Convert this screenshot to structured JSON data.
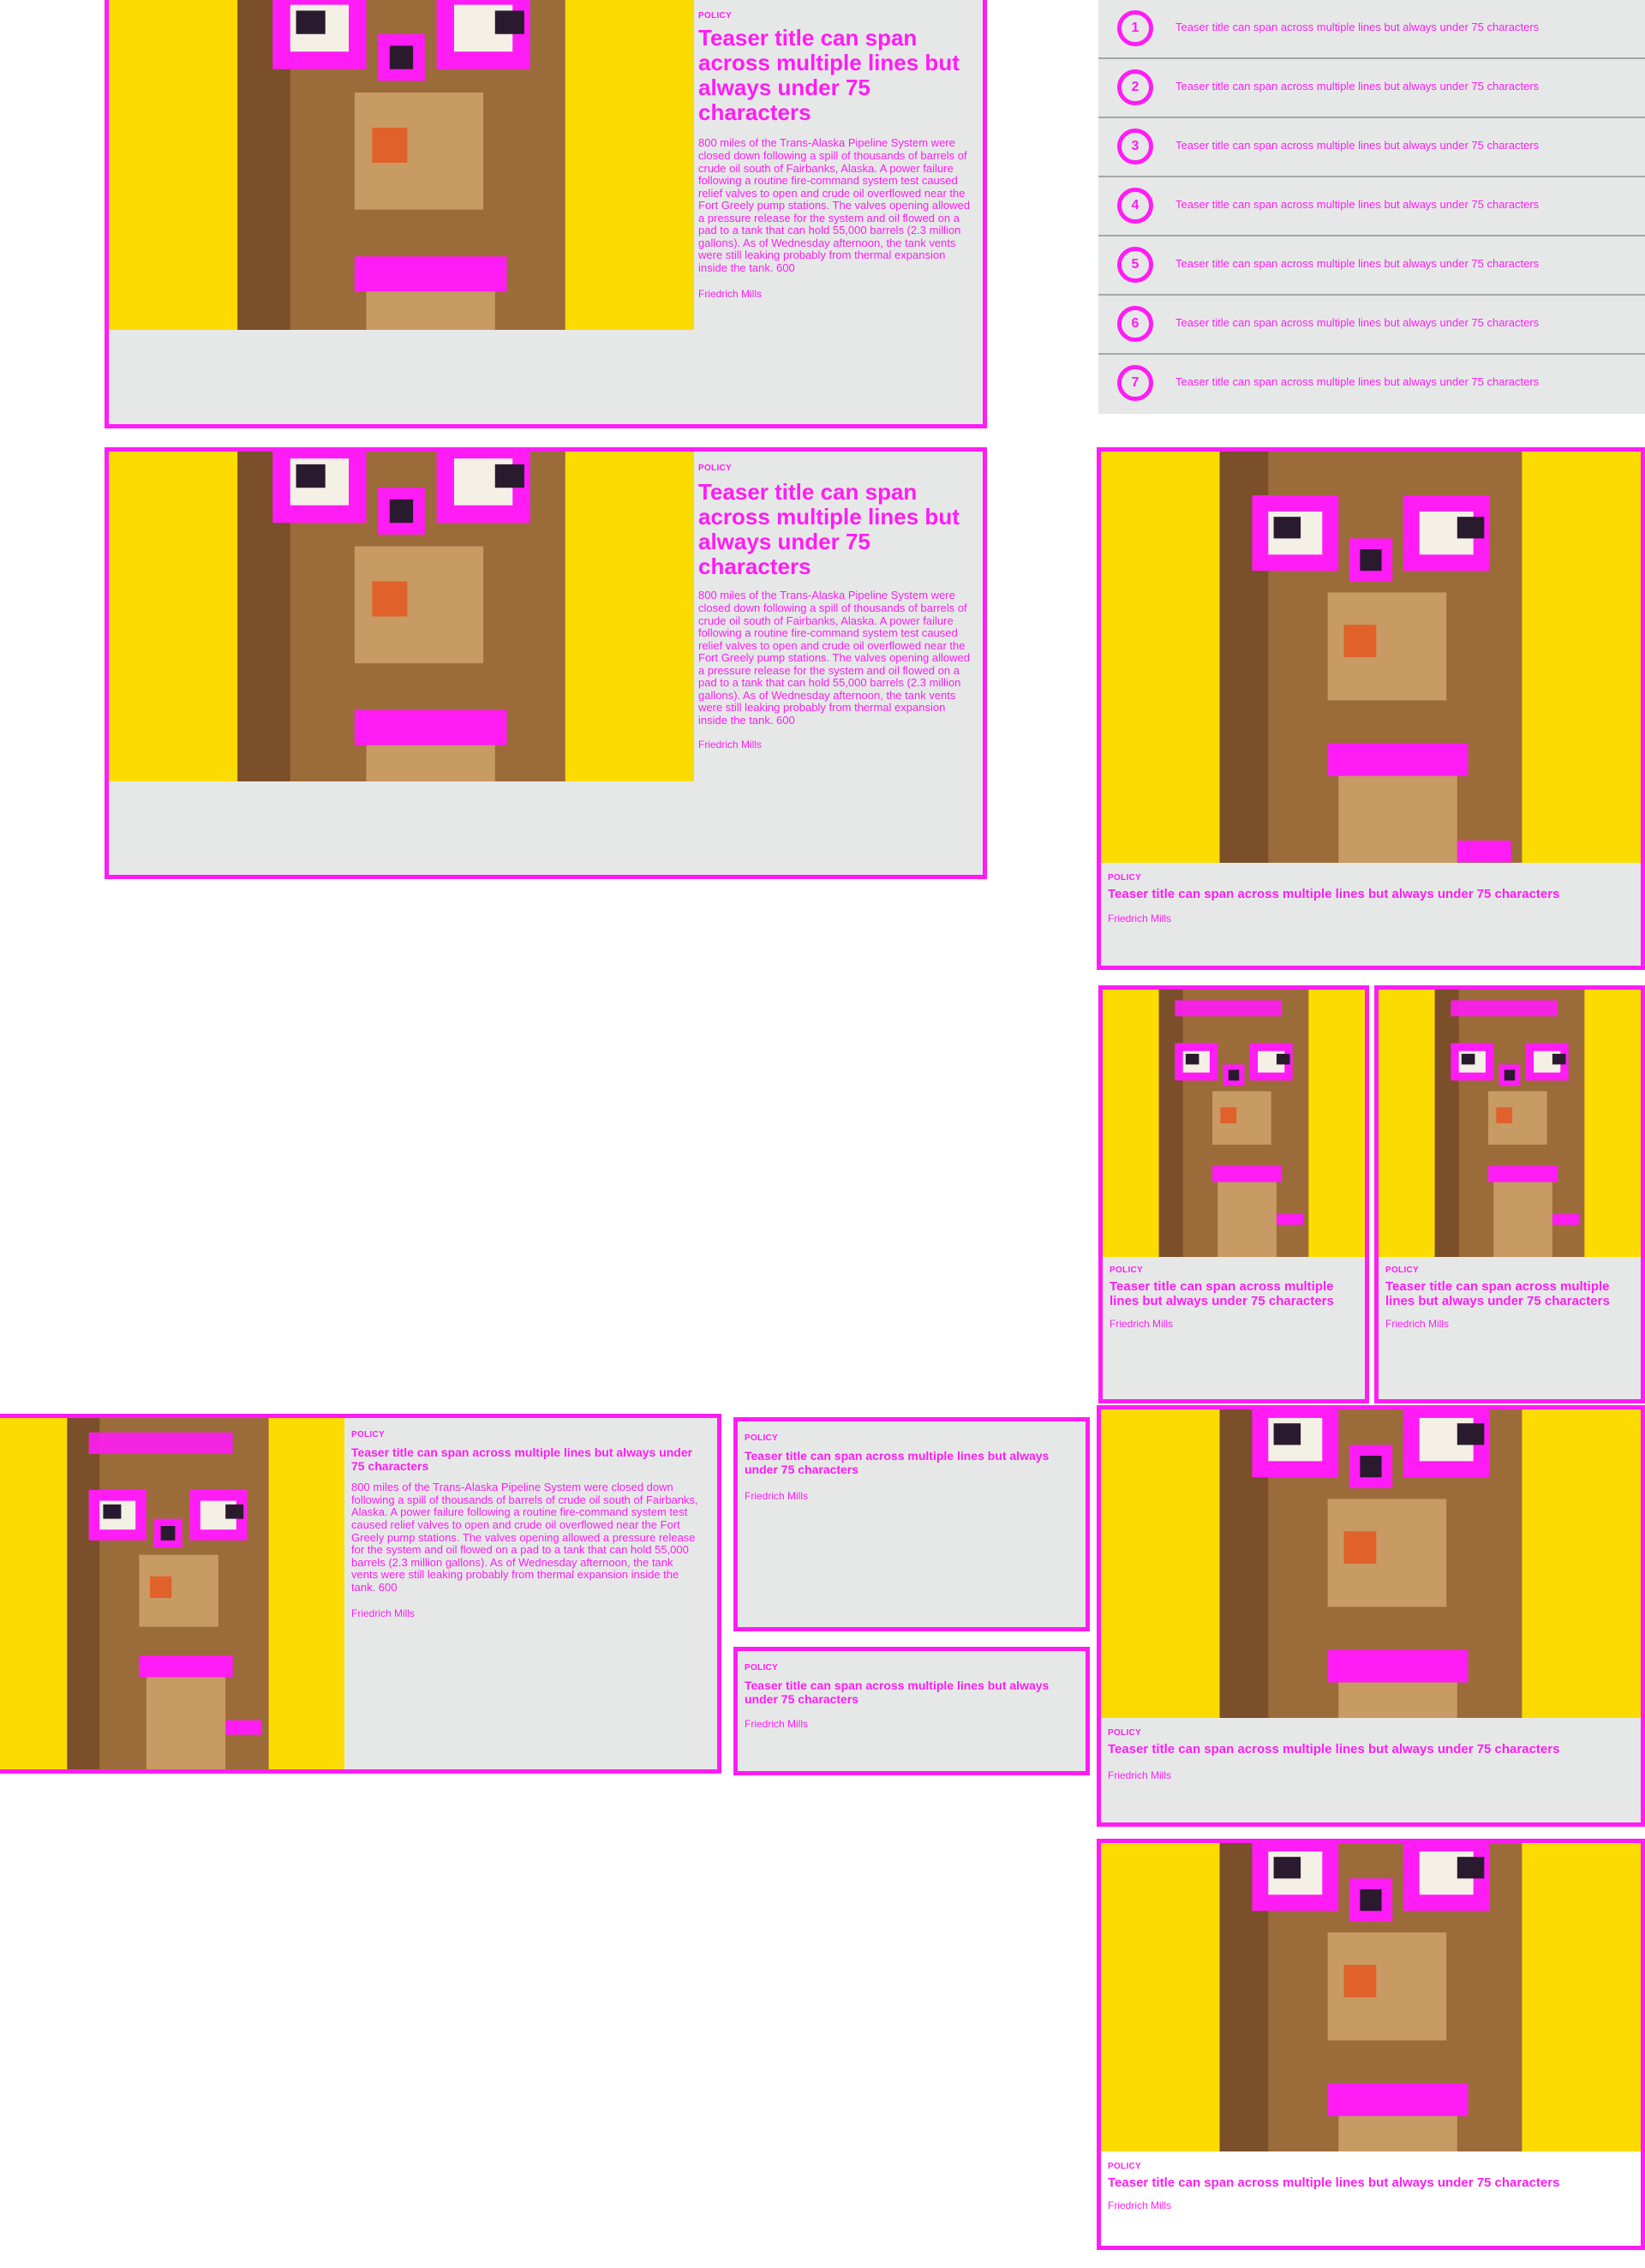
{
  "theme": {
    "accent": "#ff1cf5",
    "card_bg": "#e6e8e8",
    "image_bg": "#fcdb00",
    "divider": "#a6a8a8"
  },
  "image": {
    "icon": "pixel-bear-illustration"
  },
  "article": {
    "tag": "POLICY",
    "title": "Teaser title can span across multiple lines but always under 75 characters",
    "body": "800 miles of the Trans-Alaska Pipeline System were closed down following a spill of thousands of barrels of crude oil south of Fairbanks, Alaska. A power failure following a routine fire-command system test caused relief valves to open and crude oil overflowed near the Fort Greely pump stations. The valves opening allowed a pressure release for the system and oil flowed on a pad to a tank that can hold 55,000 barrels (2.3 million gallons). As of Wednesday afternoon, the tank vents were still leaking probably from thermal expansion inside the tank. 600",
    "author": "Friedrich Mills"
  },
  "numbered_list": {
    "items": [
      {
        "number": "1",
        "text": "Teaser title can span across multiple lines but always under 75 characters"
      },
      {
        "number": "2",
        "text": "Teaser title can span across multiple lines but always under 75 characters"
      },
      {
        "number": "3",
        "text": "Teaser title can span across multiple lines but always under 75 characters"
      },
      {
        "number": "4",
        "text": "Teaser title can span across multiple lines but always under 75 characters"
      },
      {
        "number": "5",
        "text": "Teaser title can span across multiple lines but always under 75 characters"
      },
      {
        "number": "6",
        "text": "Teaser title can span across multiple lines but always under 75 characters"
      },
      {
        "number": "7",
        "text": "Teaser title can span across multiple lines but always under 75 characters"
      }
    ]
  }
}
